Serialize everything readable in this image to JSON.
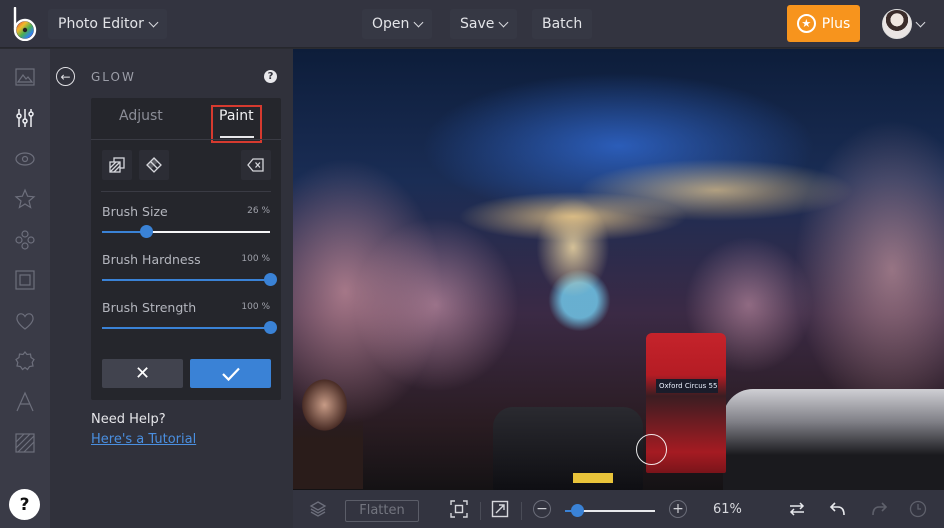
{
  "topbar": {
    "app_menu_label": "Photo Editor",
    "open_label": "Open",
    "save_label": "Save",
    "batch_label": "Batch",
    "plus_label": "Plus",
    "plus_color": "#f7941d"
  },
  "rail": {
    "items": [
      {
        "name": "image",
        "icon": "landscape-icon"
      },
      {
        "name": "edit",
        "icon": "sliders-icon",
        "active": true
      },
      {
        "name": "effects",
        "icon": "eye-icon"
      },
      {
        "name": "touch-up",
        "icon": "star-icon"
      },
      {
        "name": "graphics",
        "icon": "circles-icon"
      },
      {
        "name": "frames",
        "icon": "frame-icon"
      },
      {
        "name": "overlays",
        "icon": "heart-icon"
      },
      {
        "name": "textures",
        "icon": "badge-icon"
      },
      {
        "name": "text",
        "icon": "letter-a-icon"
      },
      {
        "name": "backgrounds",
        "icon": "hatched-square-icon"
      }
    ],
    "help_label": "?"
  },
  "panel": {
    "title": "GLOW",
    "help_label": "?",
    "tabs": [
      {
        "label": "Adjust",
        "active": false
      },
      {
        "label": "Paint",
        "active": true
      }
    ],
    "tools": [
      {
        "name": "invert-mask",
        "icon": "layers-hatched-icon"
      },
      {
        "name": "eraser",
        "icon": "eraser-icon"
      },
      {
        "name": "clear",
        "icon": "backspace-icon"
      }
    ],
    "sliders": [
      {
        "label": "Brush Size",
        "value": 26,
        "value_text": "26 %"
      },
      {
        "label": "Brush Hardness",
        "value": 100,
        "value_text": "100 %"
      },
      {
        "label": "Brush Strength",
        "value": 100,
        "value_text": "100 %"
      }
    ],
    "cancel_label": "✕",
    "apply_label": "✓",
    "accent": "#3a82d6",
    "need_help": "Need Help?",
    "tutorial_link": "Here's a Tutorial"
  },
  "canvas": {
    "bus_sign": "Oxford Circus 55"
  },
  "bottombar": {
    "flatten_label": "Flatten",
    "zoom_minus": "−",
    "zoom_plus": "+",
    "zoom_value": 61,
    "zoom_text": "61%"
  }
}
